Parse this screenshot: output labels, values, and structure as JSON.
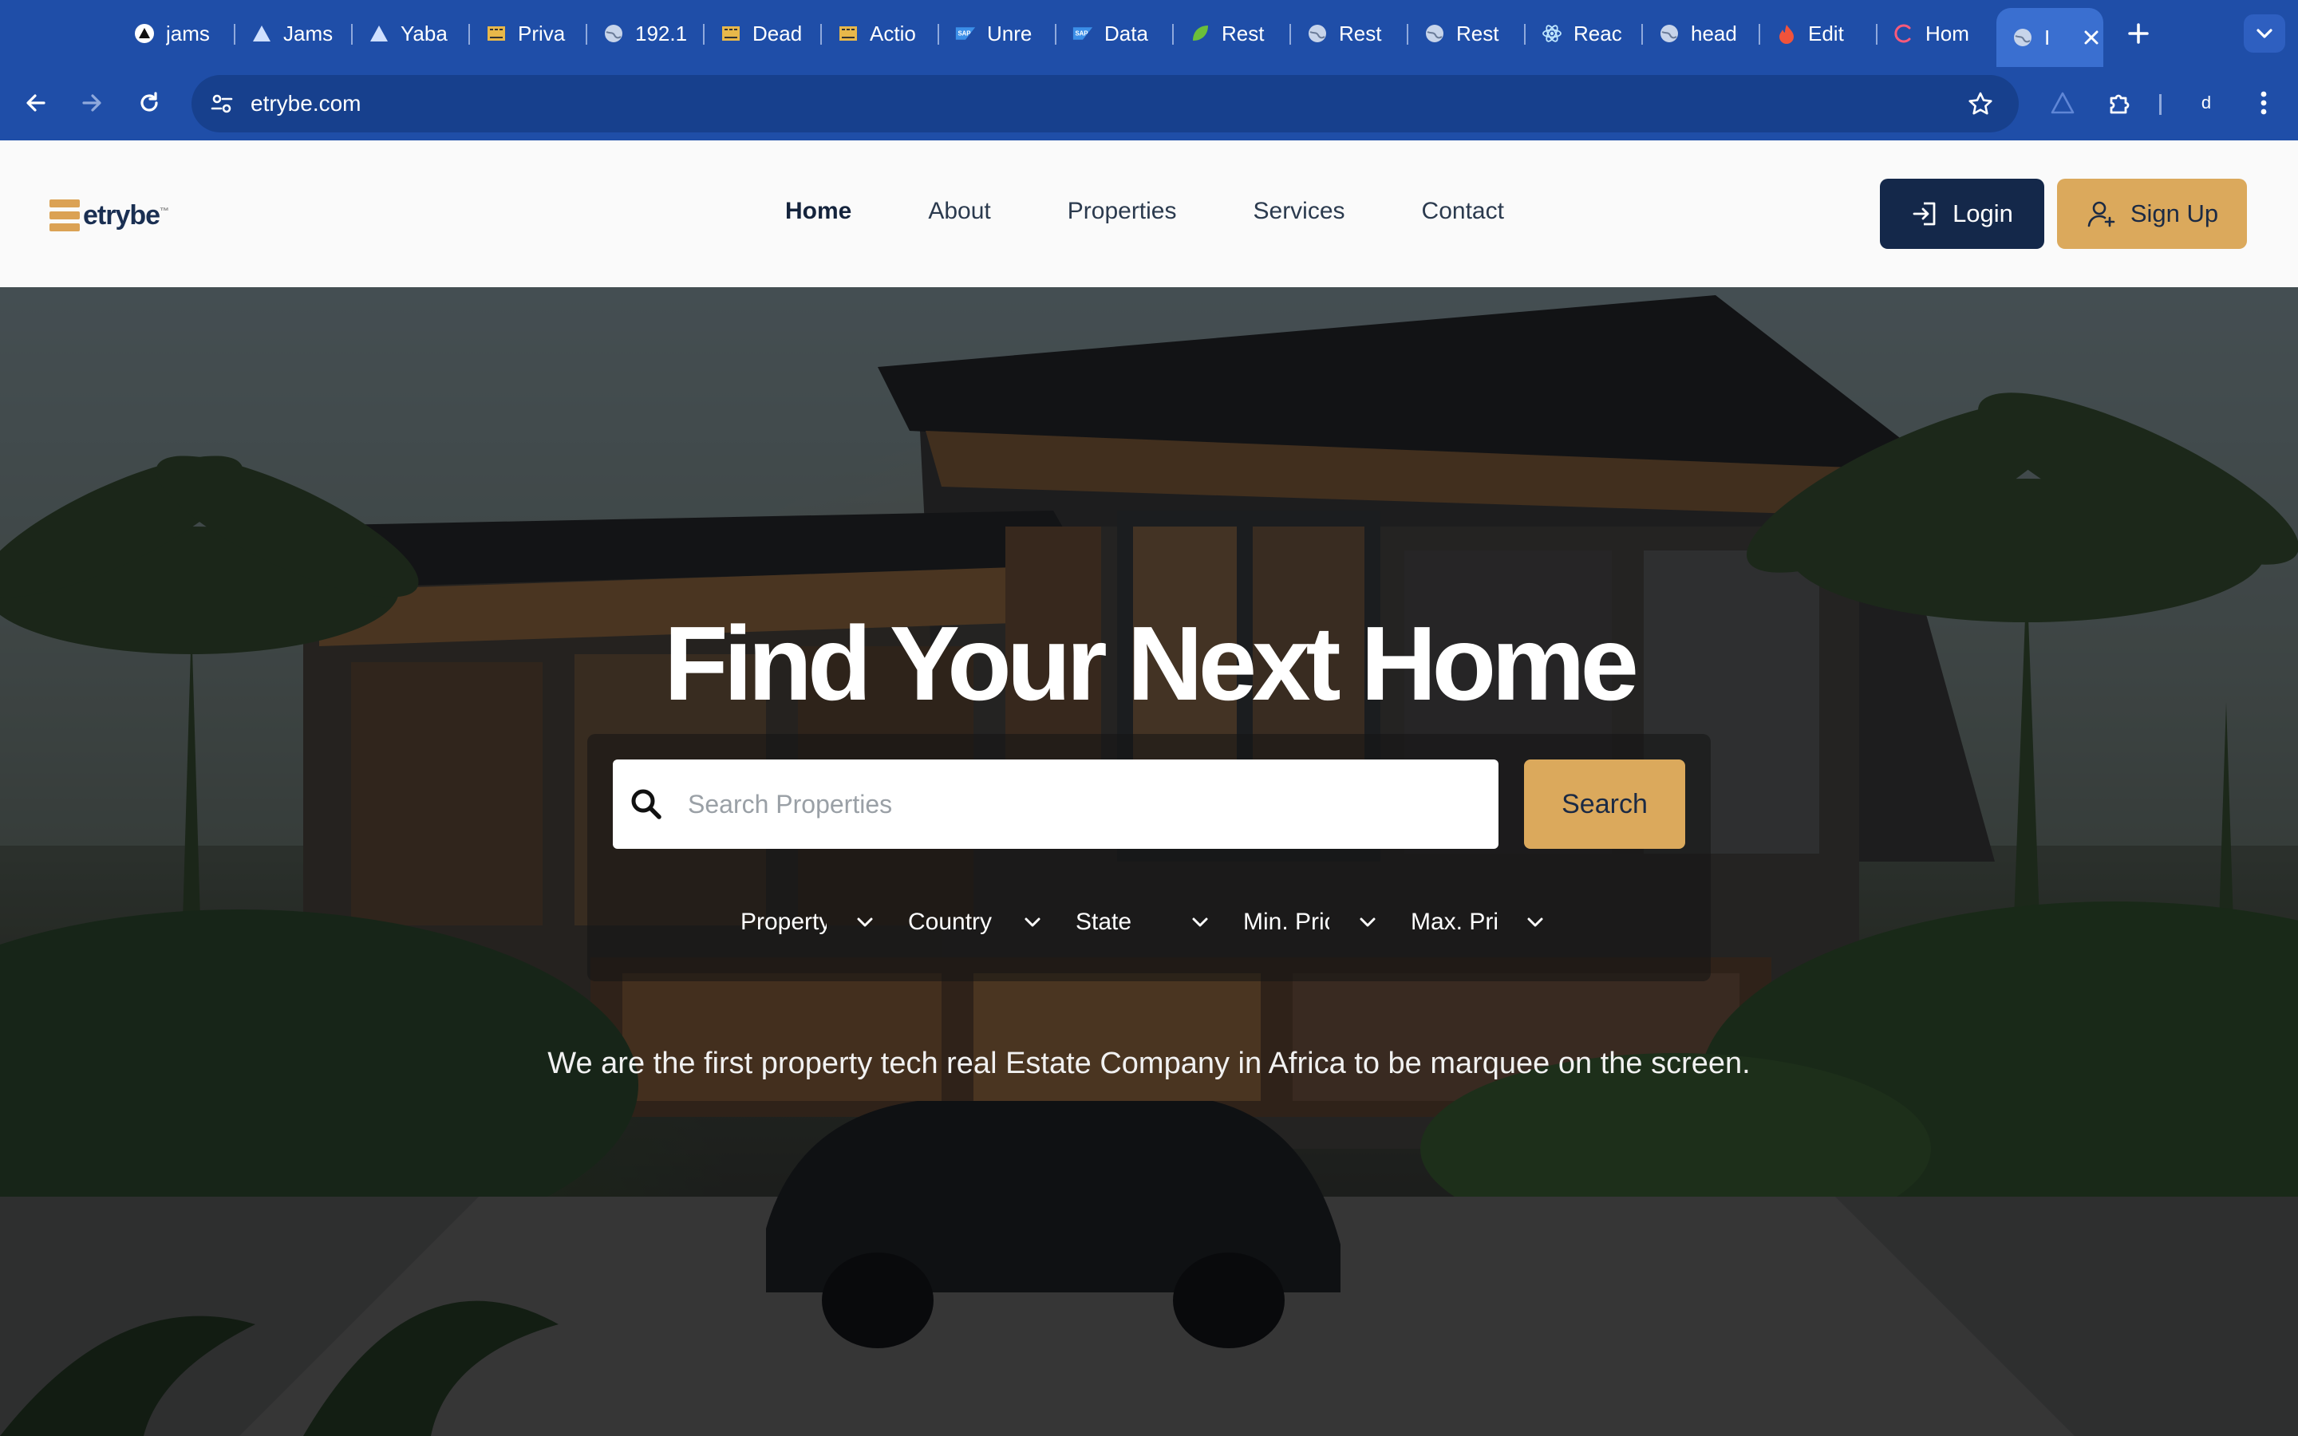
{
  "browser": {
    "tabs": [
      {
        "label": "jams",
        "icon": "triangle-circle-icon"
      },
      {
        "label": "Jams",
        "icon": "triangle-icon"
      },
      {
        "label": "Yaba",
        "icon": "triangle-icon"
      },
      {
        "label": "Priva",
        "icon": "movie-icon"
      },
      {
        "label": "192.1",
        "icon": "globe-icon"
      },
      {
        "label": "Dead",
        "icon": "movie-icon"
      },
      {
        "label": "Actio",
        "icon": "movie-icon"
      },
      {
        "label": "Unre",
        "icon": "sap-icon"
      },
      {
        "label": "Data",
        "icon": "sap-icon"
      },
      {
        "label": "Rest",
        "icon": "leaf-icon"
      },
      {
        "label": "Rest",
        "icon": "globe-icon"
      },
      {
        "label": "Rest",
        "icon": "globe-icon"
      },
      {
        "label": "Reac",
        "icon": "react-icon"
      },
      {
        "label": "head",
        "icon": "globe-icon"
      },
      {
        "label": "Edit",
        "icon": "flame-icon"
      },
      {
        "label": "Hom",
        "icon": "c-icon"
      },
      {
        "label": "I",
        "icon": "globe-icon"
      }
    ],
    "url": "etrybe.com",
    "profile_initial": "d"
  },
  "site": {
    "logo_text": "etrybe",
    "logo_tm": "™",
    "nav": [
      {
        "label": "Home",
        "active": true
      },
      {
        "label": "About",
        "active": false
      },
      {
        "label": "Properties",
        "active": false
      },
      {
        "label": "Services",
        "active": false
      },
      {
        "label": "Contact",
        "active": false
      }
    ],
    "login_label": "Login",
    "signup_label": "Sign Up"
  },
  "hero": {
    "title": "Find Your Next Home",
    "search_placeholder": "Search Properties",
    "search_button": "Search",
    "filters": [
      "Property",
      "Country",
      "State",
      "Min. Price",
      "Max. Price"
    ],
    "tagline": "We are the first property tech real Estate Company in Africa to be marquee on the screen."
  },
  "colors": {
    "chrome_blue": "#1f4ea8",
    "navy": "#14284a",
    "gold": "#dba95c"
  }
}
